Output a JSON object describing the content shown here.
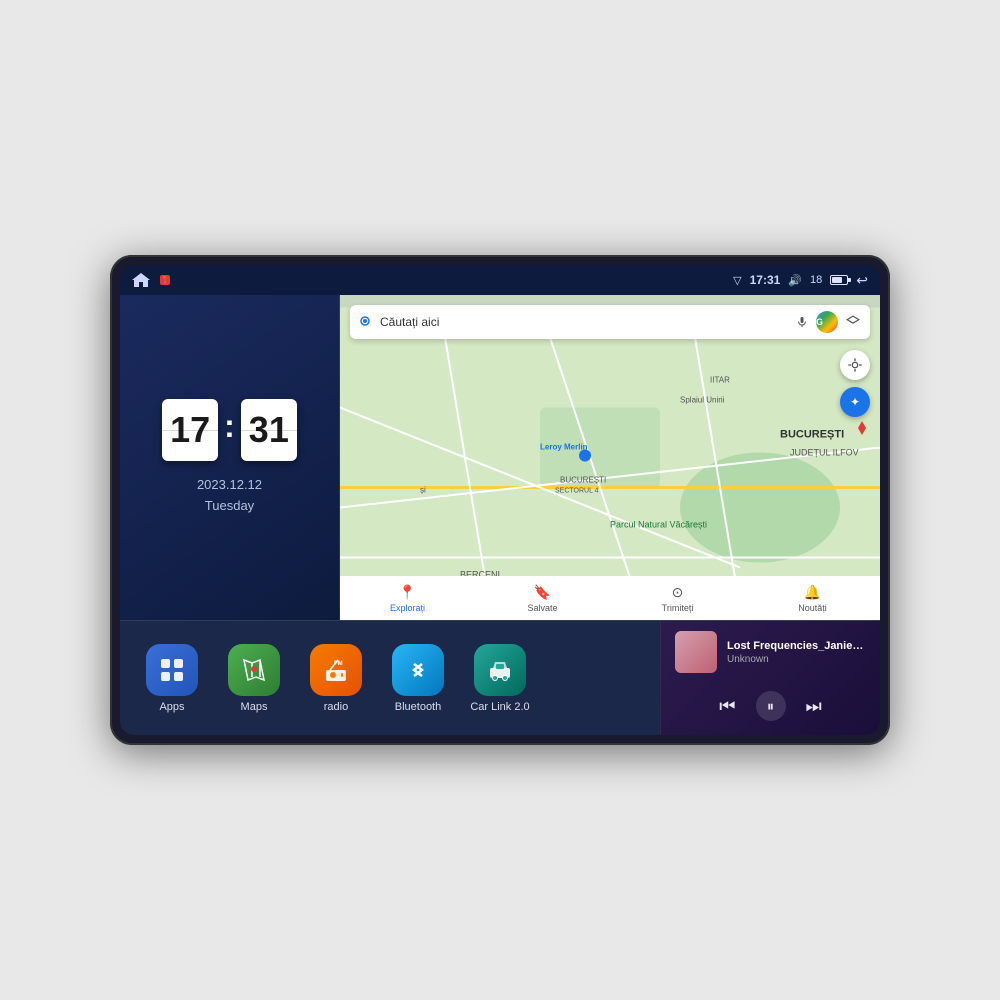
{
  "device": {
    "title": "Car Android Head Unit"
  },
  "statusBar": {
    "signal_icon": "▽",
    "time": "17:31",
    "volume_icon": "🔊",
    "battery_level": "18",
    "back_icon": "↩"
  },
  "clock": {
    "hours": "17",
    "minutes": "31",
    "date": "2023.12.12",
    "day": "Tuesday"
  },
  "map": {
    "search_placeholder": "Căutați aici",
    "nav_items": [
      {
        "label": "Explorați",
        "icon": "📍",
        "active": true
      },
      {
        "label": "Salvate",
        "icon": "🔖",
        "active": false
      },
      {
        "label": "Trimiteți",
        "icon": "⊙",
        "active": false
      },
      {
        "label": "Noutăți",
        "icon": "🔔",
        "active": false
      }
    ]
  },
  "apps": [
    {
      "label": "Apps",
      "icon": "⊞",
      "bg_color": "#3a6fd8"
    },
    {
      "label": "Maps",
      "icon": "📍",
      "bg_color": "#4caf50"
    },
    {
      "label": "radio",
      "icon": "📻",
      "bg_color": "#f57c00"
    },
    {
      "label": "Bluetooth",
      "icon": "₿",
      "bg_color": "#29b6f6"
    },
    {
      "label": "Car Link 2.0",
      "icon": "🚗",
      "bg_color": "#26a69a"
    }
  ],
  "music": {
    "title": "Lost Frequencies_Janieck Devy-...",
    "artist": "Unknown",
    "prev_icon": "⏮",
    "play_icon": "⏸",
    "next_icon": "⏭"
  }
}
